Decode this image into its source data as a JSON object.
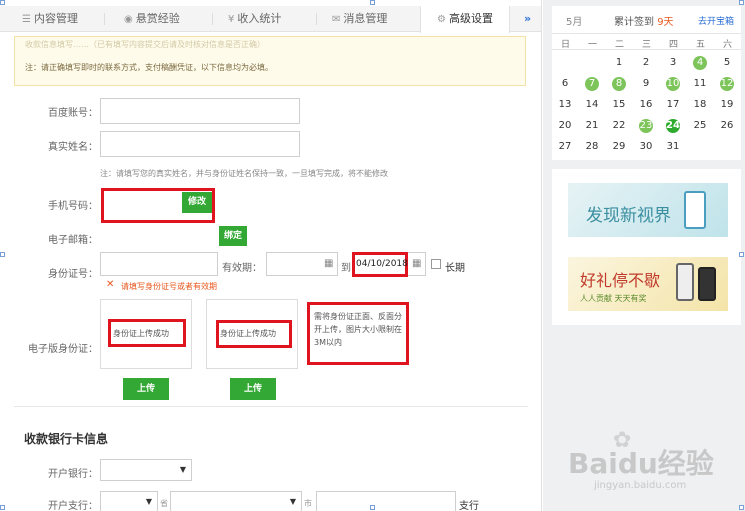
{
  "tabs": [
    {
      "label": "内容管理",
      "icon": "list-icon"
    },
    {
      "label": "悬赏经验",
      "icon": "coin-icon"
    },
    {
      "label": "收入统计",
      "icon": "yen-icon"
    },
    {
      "label": "消息管理",
      "icon": "message-icon"
    },
    {
      "label": "高级设置",
      "icon": "gear-icon"
    }
  ],
  "tabs_more": "»",
  "notice": {
    "line1": "收款信息填写……（已有填写内容提交后请及时核对信息是否正确）",
    "line2": "注：请正确填写即时的联系方式，支付稿酬凭证，以下信息均为必填。"
  },
  "form": {
    "baidu_account_label": "百度账号：",
    "real_name_label": "真实姓名：",
    "real_name_hint": "注：请填写您的真实姓名，并与身份证姓名保持一致，一旦填写完成，将不能修改",
    "phone_label": "手机号码：",
    "phone_modify": "修改",
    "email_label": "电子邮箱：",
    "email_bind": "绑定",
    "idcard_label": "身份证号：",
    "valid_label": "有效期：",
    "to_label": "到",
    "end_date": "04/10/2018",
    "long_term": "长期",
    "id_error": "请填写身份证号或者有效期",
    "e_id_label": "电子版身份证：",
    "upload_front_status": "身份证上传成功",
    "upload_back_status": "身份证上传成功",
    "upload_tip": "需将身份证正面、反面分开上传，图片大小限制在3M以内",
    "upload_btn": "上传",
    "bank_section_title": "收款银行卡信息",
    "bank_label": "开户银行：",
    "branch_label": "开户支行：",
    "province_suffix": "省",
    "city_suffix": "市",
    "branch_suffix": "支行"
  },
  "calendar": {
    "month": "5月",
    "checkin_prefix": "累计签到",
    "checkin_days": "9天",
    "open_box": "去开宝箱",
    "weekdays": [
      "日",
      "一",
      "二",
      "三",
      "四",
      "五",
      "六"
    ],
    "weeks": [
      [
        {
          "d": ""
        },
        {
          "d": ""
        },
        {
          "d": "1"
        },
        {
          "d": "2"
        },
        {
          "d": "3"
        },
        {
          "d": "4",
          "on": true
        },
        {
          "d": "5"
        }
      ],
      [
        {
          "d": "6"
        },
        {
          "d": "7",
          "on": true
        },
        {
          "d": "8",
          "on": true
        },
        {
          "d": "9"
        },
        {
          "d": "10",
          "on": true
        },
        {
          "d": "11"
        },
        {
          "d": "12",
          "on": true
        }
      ],
      [
        {
          "d": "13"
        },
        {
          "d": "14"
        },
        {
          "d": "15"
        },
        {
          "d": "16"
        },
        {
          "d": "17"
        },
        {
          "d": "18"
        },
        {
          "d": "19"
        }
      ],
      [
        {
          "d": "20"
        },
        {
          "d": "21"
        },
        {
          "d": "22"
        },
        {
          "d": "23",
          "on": true
        },
        {
          "d": "24",
          "today": true
        },
        {
          "d": "25"
        },
        {
          "d": "26"
        }
      ],
      [
        {
          "d": "27"
        },
        {
          "d": "28"
        },
        {
          "d": "29"
        },
        {
          "d": "30"
        },
        {
          "d": "31"
        },
        {
          "d": ""
        },
        {
          "d": ""
        }
      ]
    ]
  },
  "ads": {
    "ad1_text": "发现新视界",
    "ad2_text": "好礼停不歇",
    "ad2_sub": "人人贡献 天天有奖"
  },
  "watermark": {
    "brand": "Baidu经验",
    "url": "jingyan.baidu.com"
  },
  "colors": {
    "accent": "#33a834",
    "highlight": "#e0141e",
    "checkin_on": "#7dc55b",
    "orange": "#e8581e"
  }
}
